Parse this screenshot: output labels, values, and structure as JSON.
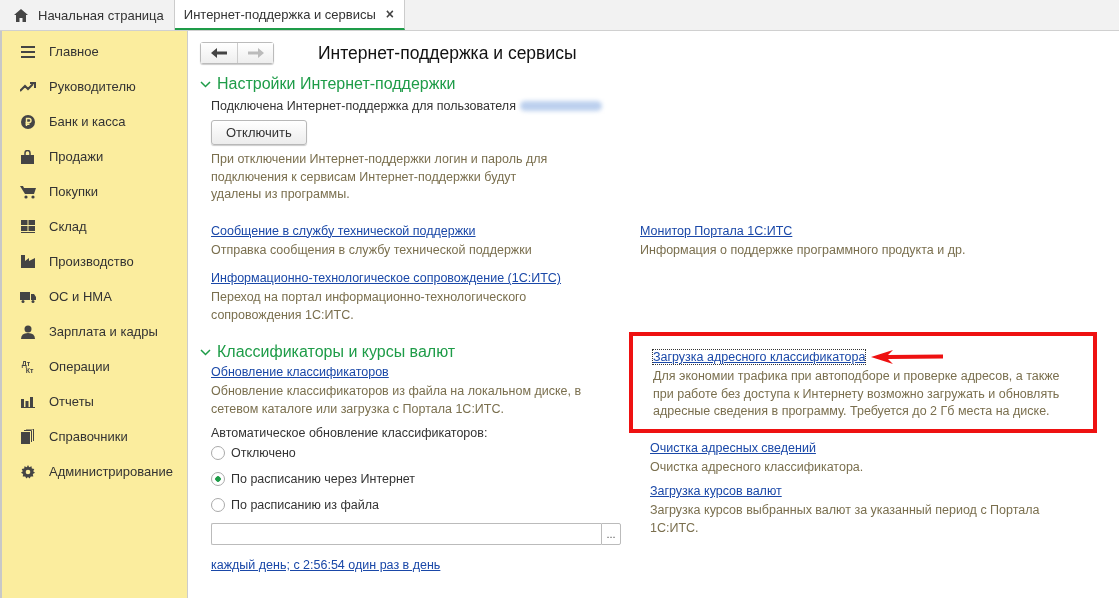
{
  "tabs": [
    {
      "label": "Начальная страница",
      "kind": "home",
      "selected": false
    },
    {
      "label": "Интернет-поддержка и сервисы",
      "kind": "page",
      "selected": true,
      "close": "×"
    }
  ],
  "sidebar": {
    "items": [
      {
        "label": "Главное",
        "kind": "menu"
      },
      {
        "label": "Руководителю",
        "kind": "trend"
      },
      {
        "label": "Банк и касса",
        "kind": "ruble"
      },
      {
        "label": "Продажи",
        "kind": "bag"
      },
      {
        "label": "Покупки",
        "kind": "cart"
      },
      {
        "label": "Склад",
        "kind": "grid"
      },
      {
        "label": "Производство",
        "kind": "factory"
      },
      {
        "label": "ОС и НМА",
        "kind": "truck"
      },
      {
        "label": "Зарплата и кадры",
        "kind": "person"
      },
      {
        "label": "Операции",
        "kind": "text",
        "icon_text": [
          "Дт",
          "Кт"
        ]
      },
      {
        "label": "Отчеты",
        "kind": "bars"
      },
      {
        "label": "Справочники",
        "kind": "books"
      },
      {
        "label": "Администрирование",
        "kind": "gear"
      }
    ]
  },
  "nav": {
    "back": {
      "disabled": false
    },
    "forward": {
      "disabled": true
    }
  },
  "title": "Интернет-поддержка и сервисы",
  "sections": [
    {
      "title": "Настройки Интернет-поддержки",
      "expanded": true,
      "status": "Подключена Интернет-поддержка для пользователя",
      "button": "Отключить",
      "note": "При отключении Интернет-поддержки логин и пароль для подключения к сервисам Интернет-поддержки будут удалены из программы.",
      "left_links": [
        {
          "link": "Сообщение в службу технической поддержки",
          "description": "Отправка сообщения в службу технической поддержки"
        },
        {
          "link": "Информационно-технологическое сопровождение (1С:ИТС)",
          "description": "Переход на портал информационно-технологического сопровождения 1С:ИТС."
        }
      ],
      "right_links": [
        {
          "link": "Монитор Портала 1С:ИТС",
          "description": "Информация о поддержке программного продукта и др."
        }
      ]
    },
    {
      "title": "Классификаторы и курсы валют",
      "expanded": true,
      "left_links": [
        {
          "link": "Обновление классификаторов",
          "description": "Обновление классификаторов из файла на локальном диске, в сетевом каталоге или загрузка с Портала 1С:ИТС."
        }
      ],
      "auto_label": "Автоматическое обновление классификаторов:",
      "options": [
        {
          "label": "Отключено",
          "selected": false
        },
        {
          "label": "По расписанию через Интернет",
          "selected": true
        },
        {
          "label": "По расписанию из файла",
          "selected": false
        }
      ],
      "file_field": {
        "button": "..."
      },
      "schedule": "каждый день; с 2:56:54 один раз в день",
      "right_links": [
        {
          "link": "Загрузка адресного классификатора",
          "description": "Для экономии трафика при автоподборе и проверке адресов, а также при работе без доступа к Интернету возможно загружать и обновлять адресные сведения в программу. Требуется до 2 Гб места на диске.",
          "highlighted": true
        },
        {
          "link": "Очистка адресных сведений",
          "description": "Очистка адресного классификатора.",
          "highlighted": false
        },
        {
          "link": "Загрузка курсов валют",
          "description": "Загрузка курсов выбранных валют за указанный период с Портала 1С:ИТС.",
          "highlighted": false
        }
      ]
    }
  ]
}
